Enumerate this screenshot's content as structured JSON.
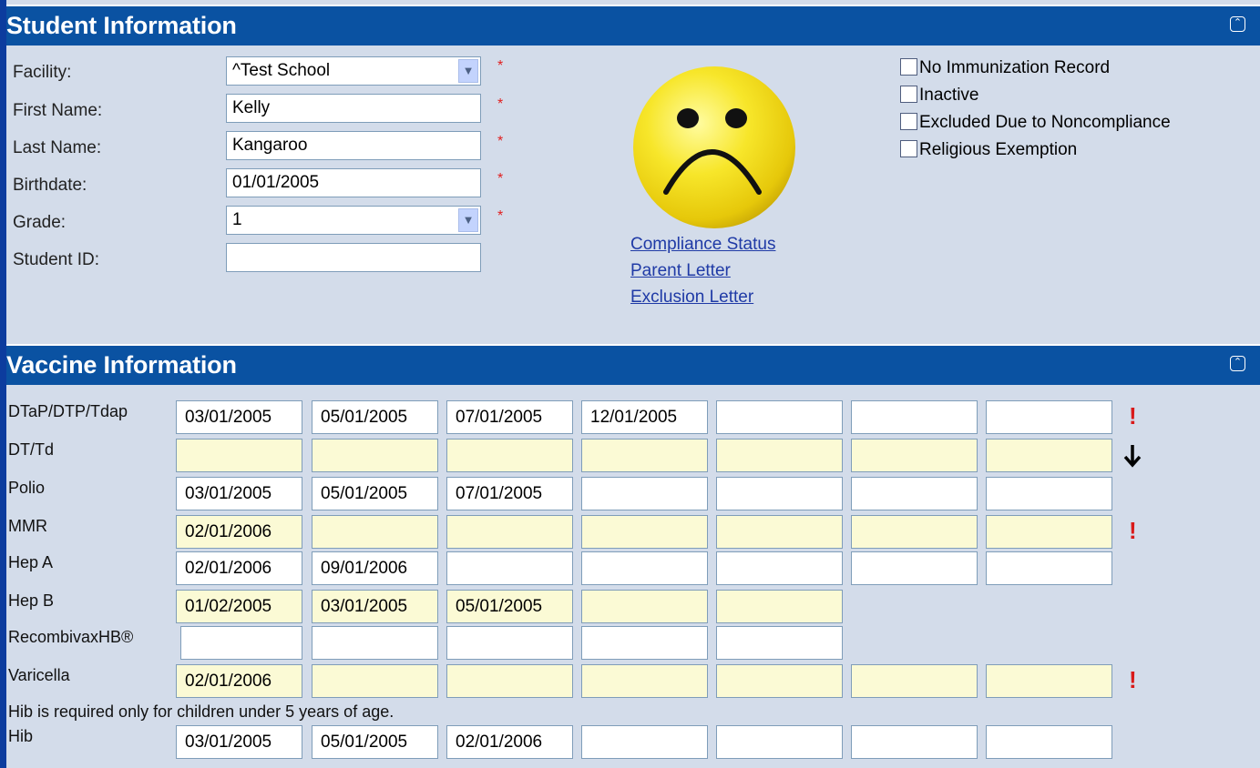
{
  "student_panel": {
    "title": "Student Information",
    "collapse_icon": "double-chevron-up-icon",
    "fields": {
      "facility": {
        "label": "Facility:",
        "value": "^Test School"
      },
      "first_name": {
        "label": "First Name:",
        "value": "Kelly"
      },
      "last_name": {
        "label": "Last Name:",
        "value": "Kangaroo"
      },
      "birthdate": {
        "label": "Birthdate:",
        "value": "01/01/2005"
      },
      "grade": {
        "label": "Grade:",
        "value": "1"
      },
      "student_id": {
        "label": "Student ID:",
        "value": ""
      }
    },
    "required_mark": "*",
    "status_icon": "sad-face-icon",
    "links": {
      "compliance": "Compliance Status",
      "parent": "Parent Letter",
      "exclusion": "Exclusion Letter"
    },
    "checkboxes": {
      "no_record": "No Immunization Record",
      "inactive": "Inactive",
      "excluded": "Excluded Due to Noncompliance",
      "religious": "Religious Exemption"
    }
  },
  "vaccine_panel": {
    "title": "Vaccine Information",
    "collapse_icon": "double-chevron-up-icon",
    "hib_note": "Hib is required only for children under 5 years of age.",
    "alert_mark": "!",
    "colors": {
      "highlight_row": "#fbfad5",
      "alert": "#d91a1a",
      "header": "#0a52a2"
    },
    "rows": [
      {
        "name": "DTaP/DTP/Tdap",
        "doses": [
          "03/01/2005",
          "05/01/2005",
          "07/01/2005",
          "12/01/2005",
          "",
          "",
          ""
        ],
        "status": "alert"
      },
      {
        "name": "DT/Td",
        "doses": [
          "",
          "",
          "",
          "",
          "",
          "",
          ""
        ],
        "status": "down-arrow"
      },
      {
        "name": "Polio",
        "doses": [
          "03/01/2005",
          "05/01/2005",
          "07/01/2005",
          "",
          "",
          "",
          ""
        ],
        "status": ""
      },
      {
        "name": "MMR",
        "doses": [
          "02/01/2006",
          "",
          "",
          "",
          "",
          "",
          ""
        ],
        "status": "alert"
      },
      {
        "name": "Hep A",
        "doses": [
          "02/01/2006",
          "09/01/2006",
          "",
          "",
          "",
          "",
          ""
        ],
        "status": ""
      },
      {
        "name": "Hep B",
        "doses": [
          "01/02/2005",
          "03/01/2005",
          "05/01/2005",
          "",
          ""
        ],
        "status": ""
      },
      {
        "name": "RecombivaxHB®",
        "doses": [
          "",
          "",
          "",
          "",
          ""
        ],
        "status": ""
      },
      {
        "name": "Varicella",
        "doses": [
          "02/01/2006",
          "",
          "",
          "",
          "",
          "",
          ""
        ],
        "status": "alert"
      },
      {
        "name": "Hib",
        "doses": [
          "03/01/2005",
          "05/01/2005",
          "02/01/2006",
          "",
          "",
          "",
          ""
        ],
        "status": ""
      }
    ]
  }
}
